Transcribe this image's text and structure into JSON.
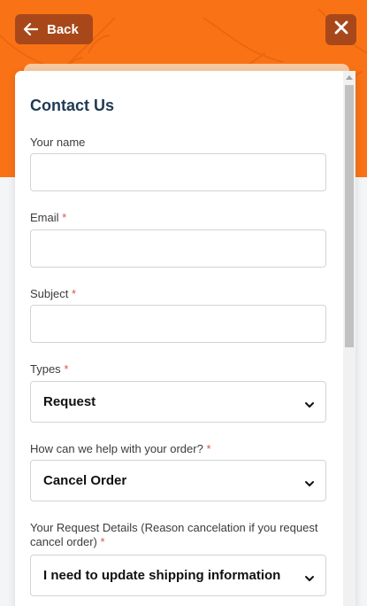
{
  "header": {
    "back_label": "Back",
    "accent": "#f97316",
    "button_bg": "#a8481a"
  },
  "form": {
    "title": "Contact Us",
    "name_label": "Your name",
    "email_label": "Email",
    "subject_label": "Subject",
    "types_label": "Types",
    "types_value": "Request",
    "help_label": "How can we help with your order?",
    "help_value": "Cancel Order",
    "details_label": "Your Request Details (Reason cancelation if you request cancel order)",
    "details_value": "I need to update shipping information",
    "required_mark": "*"
  },
  "icons": {
    "back": "arrow-left-icon",
    "close": "close-icon",
    "dropdown": "chevron-down-icon"
  }
}
